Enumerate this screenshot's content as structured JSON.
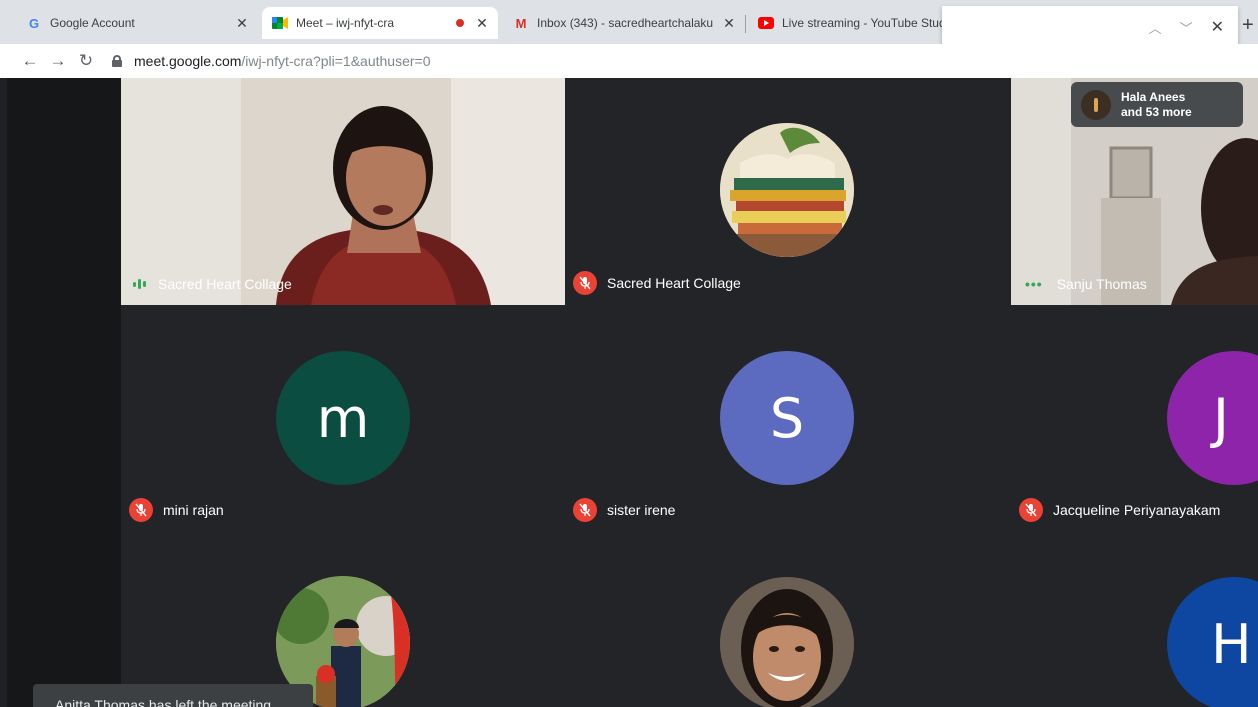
{
  "browser": {
    "tabs": [
      {
        "title": "Google Account",
        "icon": "google-g-icon"
      },
      {
        "title": "Meet – iwj-nfyt-cra",
        "icon": "meet-icon",
        "recording": true
      },
      {
        "title": "Inbox (343) - sacredheartchalaku",
        "icon": "gmail-icon"
      },
      {
        "title": "Live streaming - YouTube Stud",
        "icon": "youtube-icon"
      }
    ],
    "url_host": "meet.google.com",
    "url_path": "/iwj-nfyt-cra?pli=1&authuser=0"
  },
  "meet": {
    "participants": [
      {
        "name": "Sacred Heart Collage",
        "state": "speaking"
      },
      {
        "name": "Sacred Heart Collage",
        "state": "muted"
      },
      {
        "name": "Sanju Thomas",
        "state": "active"
      },
      {
        "name": "mini rajan",
        "state": "muted",
        "initial": "m"
      },
      {
        "name": "sister irene",
        "state": "muted",
        "initial": "S"
      },
      {
        "name": "Jacqueline Periyanayakam",
        "state": "muted",
        "initial": "J"
      },
      {
        "initial": "H"
      }
    ],
    "overflow": {
      "line1": "Hala Anees",
      "line2": "and 53 more"
    },
    "toast": "Anitta Thomas has left the meeting"
  },
  "colors": {
    "stage": "#202124",
    "muted_red": "#ea4335",
    "speaking_green": "#34a853",
    "avatar_m": "#0b4d40",
    "avatar_s": "#5c6bc0",
    "avatar_j": "#8e24aa",
    "avatar_h": "#0d47a1"
  }
}
